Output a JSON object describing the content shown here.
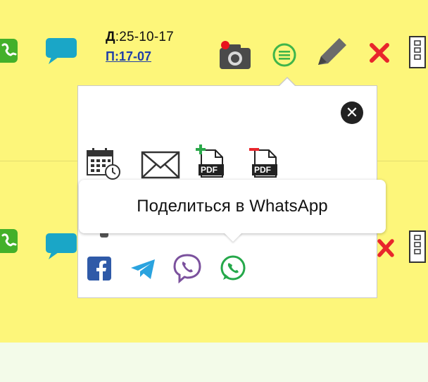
{
  "row1": {
    "date_label": "Д",
    "date_value": ":25-10-17",
    "plan_text": "П:17-07"
  },
  "popup": {
    "tooltip_text": "Поделиться в WhatsApp",
    "close_glyph": "✕",
    "pdf_label": "PDF",
    "actions": [
      "calendar-icon",
      "envelope-icon",
      "pdf-add-icon",
      "pdf-remove-icon"
    ],
    "share": [
      "facebook-icon",
      "telegram-icon",
      "viber-icon",
      "whatsapp-icon"
    ]
  },
  "colors": {
    "row_bg": "#fdf67a",
    "phone_green": "#43b02a",
    "chat_teal": "#1aa6c7",
    "delete_red": "#e8262c",
    "facebook": "#2f5aa8",
    "telegram": "#2aa3df",
    "viber": "#7b519d",
    "whatsapp": "#25a84a"
  }
}
